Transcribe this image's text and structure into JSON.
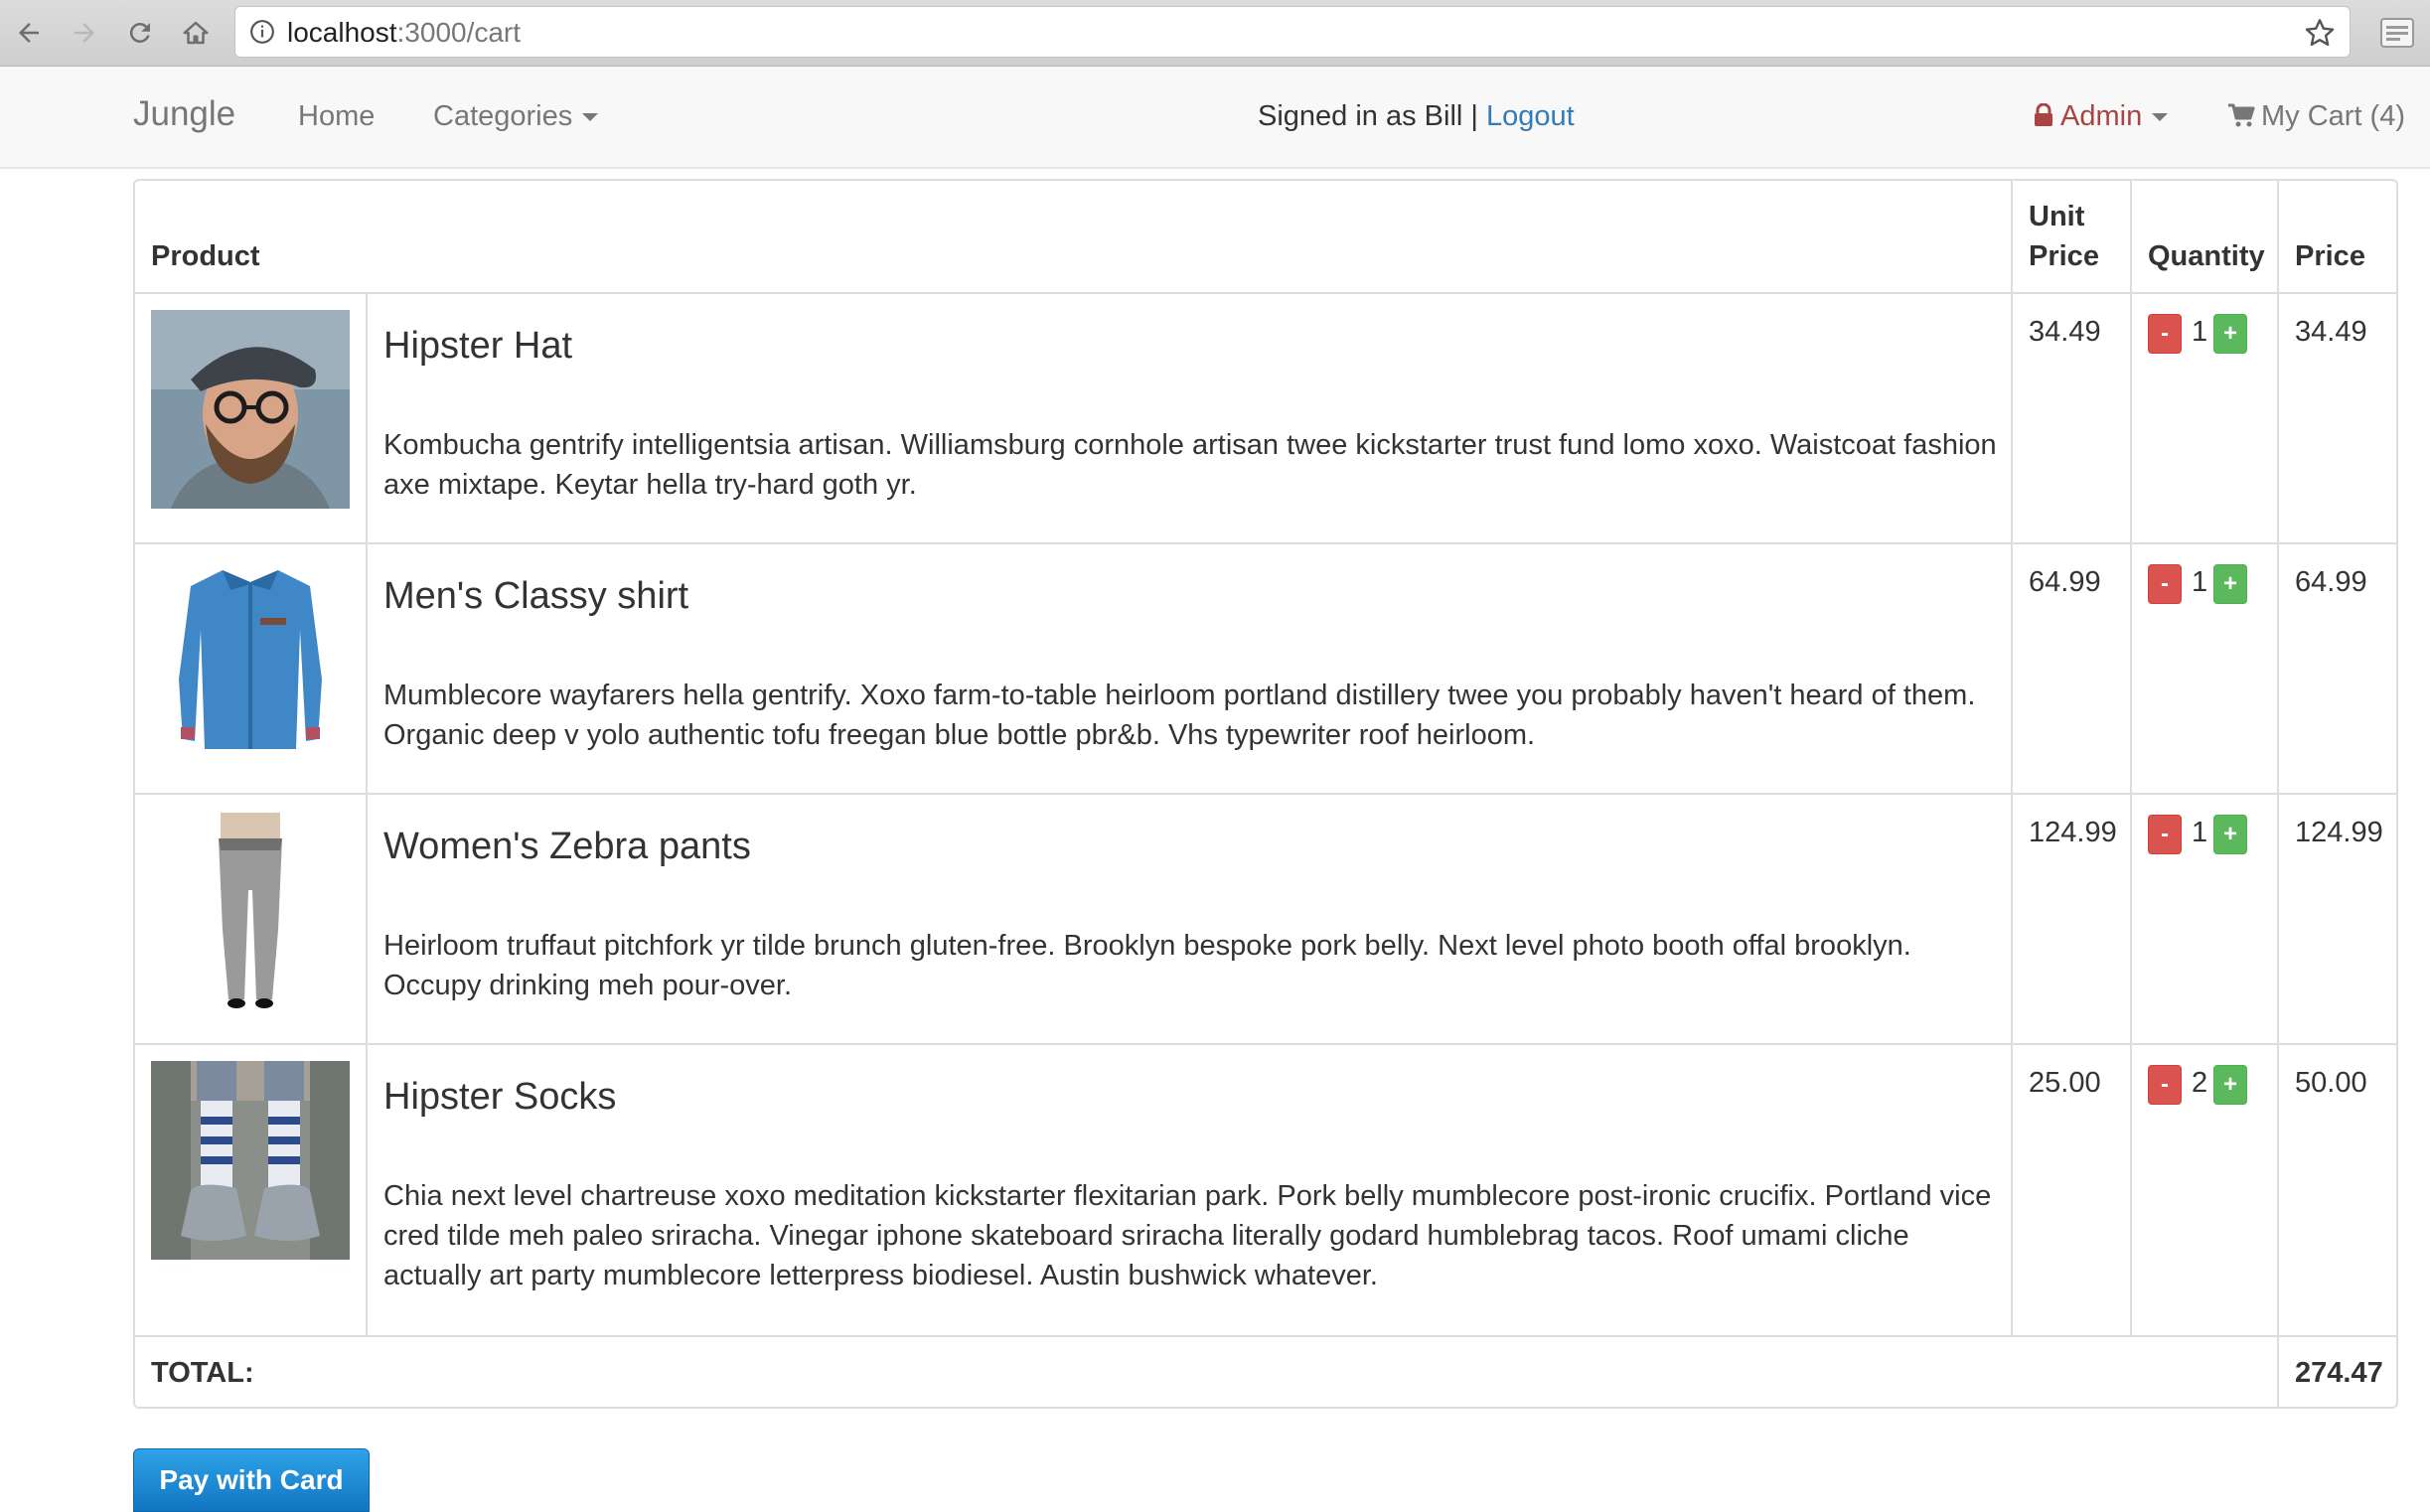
{
  "browser": {
    "url_host": "localhost",
    "url_path": ":3000/cart"
  },
  "navbar": {
    "brand": "Jungle",
    "home": "Home",
    "categories": "Categories",
    "signed_in_text": "Signed in as Bill | ",
    "logout": "Logout",
    "admin": "Admin",
    "cart": "My Cart (4)"
  },
  "table": {
    "headers": {
      "product": "Product",
      "unit_price_line1": "Unit",
      "unit_price_line2": "Price",
      "quantity": "Quantity",
      "price": "Price"
    },
    "rows": [
      {
        "name": "Hipster Hat",
        "description": "Kombucha gentrify intelligentsia artisan. Williamsburg cornhole artisan twee kickstarter trust fund lomo xoxo. Waistcoat fashion axe mixtape. Keytar hella try-hard goth yr.",
        "unit_price": "34.49",
        "quantity": "1",
        "price": "34.49"
      },
      {
        "name": "Men's Classy shirt",
        "description": "Mumblecore wayfarers hella gentrify. Xoxo farm-to-table heirloom portland distillery twee you probably haven't heard of them. Organic deep v yolo authentic tofu freegan blue bottle pbr&b. Vhs typewriter roof heirloom.",
        "unit_price": "64.99",
        "quantity": "1",
        "price": "64.99"
      },
      {
        "name": "Women's Zebra pants",
        "description": "Heirloom truffaut pitchfork yr tilde brunch gluten-free. Brooklyn bespoke pork belly. Next level photo booth offal brooklyn. Occupy drinking meh pour-over.",
        "unit_price": "124.99",
        "quantity": "1",
        "price": "124.99"
      },
      {
        "name": "Hipster Socks",
        "description": "Chia next level chartreuse xoxo meditation kickstarter flexitarian park. Pork belly mumblecore post-ironic crucifix. Portland vice cred tilde meh paleo sriracha. Vinegar iphone skateboard sriracha literally godard humblebrag tacos. Roof umami cliche actually art party mumblecore letterpress biodiesel. Austin bushwick whatever.",
        "unit_price": "25.00",
        "quantity": "2",
        "price": "50.00"
      }
    ],
    "minus_label": "-",
    "plus_label": "+",
    "total_label": "TOTAL:",
    "total_value": "274.47"
  },
  "pay_button": "Pay with Card",
  "colors": {
    "link": "#337ab7",
    "admin": "#a94442",
    "minus": "#d9534f",
    "plus": "#5cb85c",
    "pay": "#1a8ad6"
  }
}
